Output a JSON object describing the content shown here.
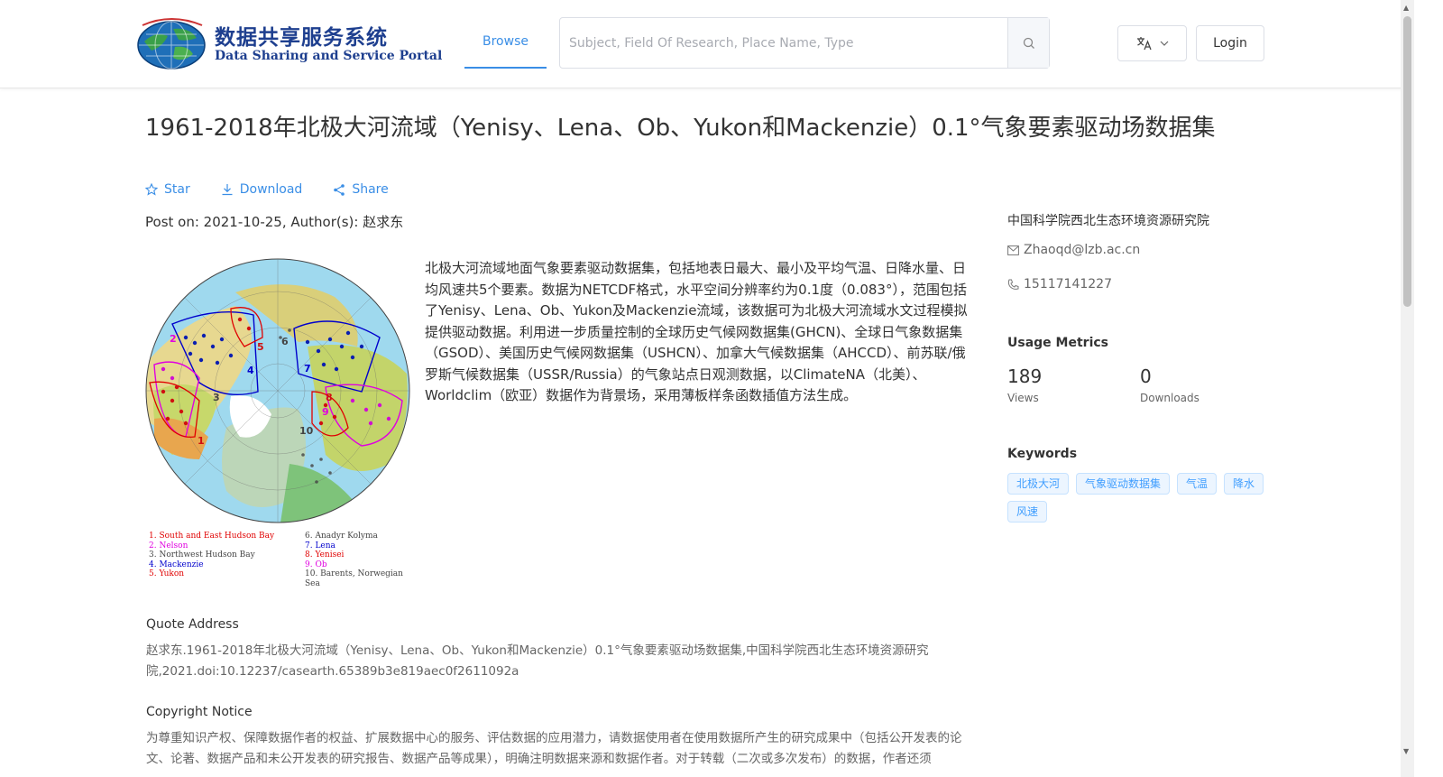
{
  "header": {
    "logo_cn": "数据共享服务系统",
    "logo_en": "Data Sharing and Service Portal",
    "nav_browse": "Browse",
    "search_placeholder": "Subject, Field Of Research, Place Name, Type",
    "login": "Login"
  },
  "dataset": {
    "title": "1961-2018年北极大河流域（Yenisy、Lena、Ob、Yukon和Mackenzie）0.1°气象要素驱动场数据集",
    "actions": {
      "star": "Star",
      "download": "Download",
      "share": "Share"
    },
    "post_line": "Post on: 2021-10-25, Author(s): 赵求东",
    "description": "北极大河流域地面气象要素驱动数据集，包括地表日最大、最小及平均气温、日降水量、日均风速共5个要素。数据为NETCDF格式，水平空间分辨率约为0.1度（0.083°），范围包括了Yenisy、Lena、Ob、Yukon及Mackenzie流域，该数据可为北极大河流域水文过程模拟提供驱动数据。利用进一步质量控制的全球历史气候网数据集(GHCN)、全球日气象数据集（GSOD）、美国历史气候网数据集（USHCN）、加拿大气候数据集（AHCCD）、前苏联/俄罗斯气候数据集（USSR/Russia）的气象站点日观测数据，以ClimateNA（北美）、Worldclim（欧亚）数据作为背景场，采用薄板样条函数插值方法生成。",
    "map_labels": [
      "1",
      "2",
      "3",
      "4",
      "5",
      "6",
      "7",
      "8",
      "9",
      "10"
    ],
    "legend": [
      {
        "text": "1. South and East Hudson Bay",
        "color": "#e00000"
      },
      {
        "text": "2. Nelson",
        "color": "#e000e0"
      },
      {
        "text": "3. Northwest Hudson Bay",
        "color": "#444444"
      },
      {
        "text": "4. Mackenzie",
        "color": "#0000cc"
      },
      {
        "text": "5. Yukon",
        "color": "#e00000"
      },
      {
        "text": "6. Anadyr Kolyma",
        "color": "#444444"
      },
      {
        "text": "7. Lena",
        "color": "#0000cc"
      },
      {
        "text": "8. Yenisei",
        "color": "#e00000"
      },
      {
        "text": "9. Ob",
        "color": "#e000e0"
      },
      {
        "text": "10. Barents, Norwegian Sea",
        "color": "#444444"
      }
    ],
    "quote_head": "Quote Address",
    "quote_body": "赵求东.1961-2018年北极大河流域（Yenisy、Lena、Ob、Yukon和Mackenzie）0.1°气象要素驱动场数据集,中国科学院西北生态环境资源研究院,2021.doi:10.12237/casearth.65389b3e819aec0f2611092a",
    "copyright_head": "Copyright Notice",
    "copyright_body": "为尊重知识产权、保障数据作者的权益、扩展数据中心的服务、评估数据的应用潜力，请数据使用者在使用数据所产生的研究成果中（包括公开发表的论文、论著、数据产品和未公开发表的研究报告、数据产品等成果），明确注明数据来源和数据作者。对于转载（二次或多次发布）的数据，作者还须"
  },
  "sidebar": {
    "institution": "中国科学院西北生态环境资源研究院",
    "email": "Zhaoqd@lzb.ac.cn",
    "phone": "15117141227",
    "usage_head": "Usage Metrics",
    "views_value": "189",
    "views_label": "Views",
    "downloads_value": "0",
    "downloads_label": "Downloads",
    "keywords_head": "Keywords",
    "keywords": [
      "北极大河",
      "气象驱动数据集",
      "气温",
      "降水",
      "风速"
    ]
  },
  "colors": {
    "accent": "#3a8ee6",
    "tag_bg": "#ecf5ff",
    "tag_border": "#c6e2ff",
    "logo_blue": "#1e3f8f"
  },
  "icons": [
    "search-icon",
    "translate-icon",
    "chevron-down-icon",
    "star-icon",
    "download-icon",
    "share-icon",
    "mail-icon",
    "phone-icon"
  ]
}
